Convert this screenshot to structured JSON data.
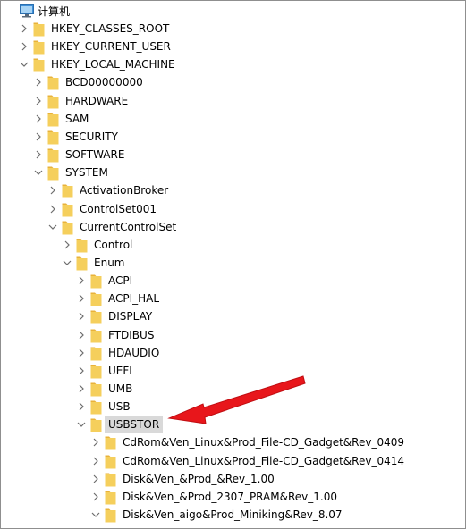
{
  "root": {
    "label": "计算机",
    "icon": "computer-icon"
  },
  "tree": [
    {
      "label": "HKEY_CLASSES_ROOT",
      "depth": 1,
      "expanded": false
    },
    {
      "label": "HKEY_CURRENT_USER",
      "depth": 1,
      "expanded": false
    },
    {
      "label": "HKEY_LOCAL_MACHINE",
      "depth": 1,
      "expanded": true
    },
    {
      "label": "BCD00000000",
      "depth": 2,
      "expanded": false
    },
    {
      "label": "HARDWARE",
      "depth": 2,
      "expanded": false
    },
    {
      "label": "SAM",
      "depth": 2,
      "expanded": false
    },
    {
      "label": "SECURITY",
      "depth": 2,
      "expanded": false
    },
    {
      "label": "SOFTWARE",
      "depth": 2,
      "expanded": false
    },
    {
      "label": "SYSTEM",
      "depth": 2,
      "expanded": true
    },
    {
      "label": "ActivationBroker",
      "depth": 3,
      "expanded": false
    },
    {
      "label": "ControlSet001",
      "depth": 3,
      "expanded": false
    },
    {
      "label": "CurrentControlSet",
      "depth": 3,
      "expanded": true
    },
    {
      "label": "Control",
      "depth": 4,
      "expanded": false
    },
    {
      "label": "Enum",
      "depth": 4,
      "expanded": true
    },
    {
      "label": "ACPI",
      "depth": 5,
      "expanded": false
    },
    {
      "label": "ACPI_HAL",
      "depth": 5,
      "expanded": false
    },
    {
      "label": "DISPLAY",
      "depth": 5,
      "expanded": false
    },
    {
      "label": "FTDIBUS",
      "depth": 5,
      "expanded": false
    },
    {
      "label": "HDAUDIO",
      "depth": 5,
      "expanded": false
    },
    {
      "label": "UEFI",
      "depth": 5,
      "expanded": false
    },
    {
      "label": "UMB",
      "depth": 5,
      "expanded": false
    },
    {
      "label": "USB",
      "depth": 5,
      "expanded": false
    },
    {
      "label": "USBSTOR",
      "depth": 5,
      "expanded": true,
      "selected": true
    },
    {
      "label": "CdRom&Ven_Linux&Prod_File-CD_Gadget&Rev_0409",
      "depth": 6,
      "expanded": false
    },
    {
      "label": "CdRom&Ven_Linux&Prod_File-CD_Gadget&Rev_0414",
      "depth": 6,
      "expanded": false
    },
    {
      "label": "Disk&Ven_&Prod_&Rev_1.00",
      "depth": 6,
      "expanded": false
    },
    {
      "label": "Disk&Ven_&Prod_2307_PRAM&Rev_1.00",
      "depth": 6,
      "expanded": false
    },
    {
      "label": "Disk&Ven_aigo&Prod_Miniking&Rev_8.07",
      "depth": 6,
      "expanded": true
    }
  ],
  "colors": {
    "folder": "#f5cf5c",
    "folder_dark": "#e8b23a",
    "selection": "#d9d9d9",
    "chevron": "#6d6d6d",
    "annotation_arrow": "#e8161b"
  }
}
